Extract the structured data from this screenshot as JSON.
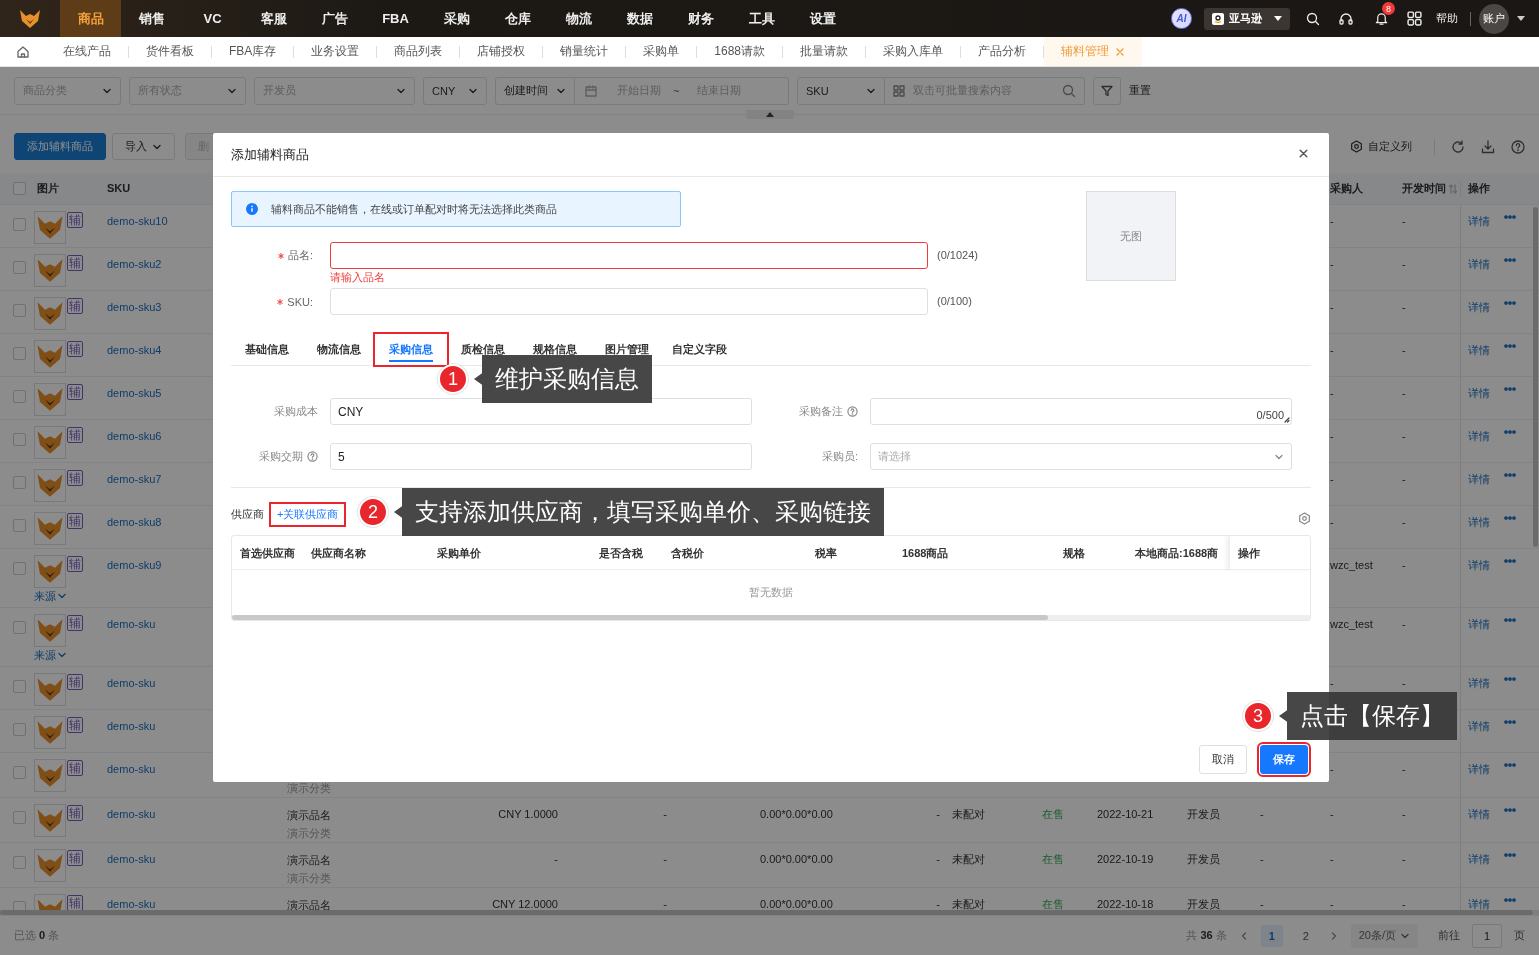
{
  "nav": {
    "menu": [
      {
        "label": "商品",
        "selected": true
      },
      {
        "label": "销售",
        "selected": false
      },
      {
        "label": "VC",
        "selected": false
      },
      {
        "label": "客服",
        "selected": false
      },
      {
        "label": "广告",
        "selected": false
      },
      {
        "label": "FBA",
        "selected": false
      },
      {
        "label": "采购",
        "selected": false
      },
      {
        "label": "仓库",
        "selected": false
      },
      {
        "label": "物流",
        "selected": false
      },
      {
        "label": "数据",
        "selected": false
      },
      {
        "label": "财务",
        "selected": false
      },
      {
        "label": "工具",
        "selected": false
      },
      {
        "label": "设置",
        "selected": false
      }
    ],
    "ai": "AI",
    "platform": "亚马逊",
    "notifications": "8",
    "help": "帮助",
    "account": "账户"
  },
  "page_tabs": [
    {
      "label": "在线产品",
      "selected": false
    },
    {
      "label": "货件看板",
      "selected": false
    },
    {
      "label": "FBA库存",
      "selected": false
    },
    {
      "label": "业务设置",
      "selected": false
    },
    {
      "label": "商品列表",
      "selected": false
    },
    {
      "label": "店铺授权",
      "selected": false
    },
    {
      "label": "销量统计",
      "selected": false
    },
    {
      "label": "采购单",
      "selected": false
    },
    {
      "label": "1688请款",
      "selected": false
    },
    {
      "label": "批量请款",
      "selected": false
    },
    {
      "label": "采购入库单",
      "selected": false
    },
    {
      "label": "产品分析",
      "selected": false
    },
    {
      "label": "辅料管理",
      "selected": true,
      "closable": true
    }
  ],
  "filters": [
    {
      "kind": "select",
      "placeholder": "商品分类"
    },
    {
      "kind": "select",
      "placeholder": "所有状态"
    },
    {
      "kind": "select",
      "placeholder": "开发员"
    },
    {
      "kind": "select",
      "value": "CNY"
    },
    {
      "kind": "date_range",
      "field": "创建时间",
      "start": "开始日期",
      "separator": "~",
      "end": "结束日期"
    },
    {
      "kind": "search",
      "field": "SKU",
      "placeholder": "双击可批量搜索内容"
    },
    {
      "kind": "filter_button"
    },
    {
      "kind": "reset",
      "label": "重置"
    }
  ],
  "toolbar": {
    "buttons": [
      {
        "label": "添加辅料商品",
        "kind": "primary"
      },
      {
        "label": "导入",
        "kind": "dropdown"
      },
      {
        "label": "删",
        "kind": "disabled"
      }
    ],
    "custom_columns": "自定义列"
  },
  "table": {
    "header_checked": false,
    "columns": {
      "column_2": "图片",
      "column_3": "SKU",
      "purchaser": "采购人",
      "dev_time": "开发时间",
      "actions": "操作"
    },
    "rows": [
      {
        "checked": false,
        "tag": "辅",
        "sku": "demo-sku10",
        "purchaser": "-",
        "dev_time": "-",
        "action": "详情"
      },
      {
        "checked": false,
        "tag": "辅",
        "sku": "demo-sku2",
        "purchaser": "-",
        "dev_time": "-",
        "action": "详情"
      },
      {
        "checked": false,
        "tag": "辅",
        "sku": "demo-sku3",
        "purchaser": "-",
        "dev_time": "-",
        "action": "详情"
      },
      {
        "checked": false,
        "tag": "辅",
        "sku": "demo-sku4",
        "purchaser": "-",
        "dev_time": "-",
        "action": "详情"
      },
      {
        "checked": false,
        "tag": "辅",
        "sku": "demo-sku5",
        "purchaser": "-",
        "dev_time": "-",
        "action": "详情"
      },
      {
        "checked": false,
        "tag": "辅",
        "sku": "demo-sku6",
        "purchaser": "-",
        "dev_time": "-",
        "action": "详情"
      },
      {
        "checked": false,
        "tag": "辅",
        "sku": "demo-sku7",
        "purchaser": "-",
        "dev_time": "-",
        "action": "详情"
      },
      {
        "checked": false,
        "tag": "辅",
        "sku": "demo-sku8",
        "purchaser": "-",
        "dev_time": "-",
        "action": "详情"
      },
      {
        "checked": false,
        "tag": "辅",
        "sku": "demo-sku9",
        "source": "来源",
        "purchaser": "wzc_test",
        "dev_time": "-",
        "action": "详情"
      },
      {
        "checked": false,
        "tag": "辅",
        "sku": "demo-sku",
        "source": "来源",
        "purchaser": "wzc_test",
        "dev_time": "-",
        "action": "详情"
      },
      {
        "checked": false,
        "tag": "辅",
        "sku": "demo-sku",
        "purchaser": "-",
        "dev_time": "-",
        "action": "详情"
      },
      {
        "checked": false,
        "tag": "辅",
        "sku": "demo-sku",
        "action": "详情"
      },
      {
        "checked": false,
        "tag": "辅",
        "sku": "demo-sku",
        "column_4": {
          "line_2": "演示分类"
        },
        "purchaser": "-",
        "dev_time": "-",
        "action": "详情"
      },
      {
        "checked": false,
        "tag": "辅",
        "sku": "demo-sku",
        "column_4": {
          "line_1": "演示品名",
          "line_2": "演示分类"
        },
        "column_5": "CNY 1.0000",
        "column_6": "-",
        "column_7": "0.00*0.00*0.00",
        "column_8": "-",
        "column_9": "未配对",
        "column_10": "在售",
        "column_11": "2022-10-21",
        "column_12": "开发员",
        "column_13": "-",
        "purchaser": "-",
        "dev_time": "-",
        "action": "详情"
      },
      {
        "checked": false,
        "tag": "辅",
        "sku": "demo-sku",
        "column_4": {
          "line_1": "演示品名",
          "line_2": "演示分类"
        },
        "column_5": "-",
        "column_6": "-",
        "column_7": "0.00*0.00*0.00",
        "column_8": "-",
        "column_9": "未配对",
        "column_10": "在售",
        "column_11": "2022-10-19",
        "column_12": "开发员",
        "column_13": "-",
        "purchaser": "-",
        "dev_time": "-",
        "action": "详情"
      },
      {
        "checked": false,
        "tag": "辅",
        "sku": "demo-sku",
        "column_4": {
          "line_1": "演示品名"
        },
        "column_5": "CNY 12.0000",
        "column_6": "-",
        "column_7": "0.00*0.00*0.00",
        "column_8": "-",
        "column_9": "未配对",
        "column_10": "在售",
        "column_11": "2022-10-18",
        "column_12": "开发员",
        "column_13": "-",
        "purchaser": "-",
        "dev_time": "-",
        "action": "详情"
      }
    ]
  },
  "footer": {
    "selected": "已选 **0** 条",
    "total": "共 **36** 条",
    "pages": [
      {
        "label": "1",
        "selected": true
      },
      {
        "label": "2",
        "selected": false
      }
    ],
    "page_size": "20条/页",
    "goto_label": "前往",
    "goto_value": "1",
    "goto_suffix": "页"
  },
  "dialog": {
    "title": "添加辅料商品",
    "notice": "辅料商品不能销售，在线或订单配对时将无法选择此类商品",
    "fields": [
      {
        "label": "品名:",
        "required": true,
        "invalid": true,
        "counter": "(0/1024)",
        "error": "请输入品名"
      },
      {
        "label": "SKU:",
        "required": true,
        "invalid": false,
        "counter": "(0/100)"
      }
    ],
    "image_placeholder": "无图",
    "tabs": [
      {
        "label": "基础信息",
        "selected": false,
        "highlighted": false
      },
      {
        "label": "物流信息",
        "selected": false,
        "highlighted": false
      },
      {
        "label": "采购信息",
        "selected": true,
        "highlighted": true
      },
      {
        "label": "质检信息",
        "selected": false,
        "highlighted": false
      },
      {
        "label": "规格信息",
        "selected": false,
        "highlighted": false
      },
      {
        "label": "图片管理",
        "selected": false,
        "highlighted": false
      },
      {
        "label": "自定义字段",
        "selected": false,
        "highlighted": false
      }
    ],
    "purchase_fields": [
      {
        "kind": "input",
        "label": "采购成本",
        "value": "CNY",
        "help": false
      },
      {
        "kind": "textarea",
        "label": "采购备注",
        "help": true,
        "counter": "0/500"
      },
      {
        "kind": "input",
        "label": "采购交期",
        "help": true,
        "value": "5"
      },
      {
        "kind": "select",
        "label": "采购员:",
        "help": false,
        "placeholder": "请选择"
      }
    ],
    "supplier": {
      "label": "供应商",
      "link": "+关联供应商",
      "link_highlighted": true,
      "columns": [
        "首选供应商",
        "供应商名称",
        "采购单价",
        "是否含税",
        "含税价",
        "税率",
        "1688商品",
        "规格",
        "本地商品:1688商",
        "操作"
      ],
      "empty": "暂无数据"
    },
    "buttons": [
      {
        "label": "取消",
        "kind": "default",
        "highlighted": false
      },
      {
        "label": "保存",
        "kind": "primary",
        "highlighted": true
      }
    ]
  },
  "callouts": [
    {
      "number": "1",
      "text": "维护采购信息"
    },
    {
      "number": "2",
      "text": "支持添加供应商，填写采购单价、采购链接"
    },
    {
      "number": "3",
      "text": "点击【保存】"
    }
  ]
}
